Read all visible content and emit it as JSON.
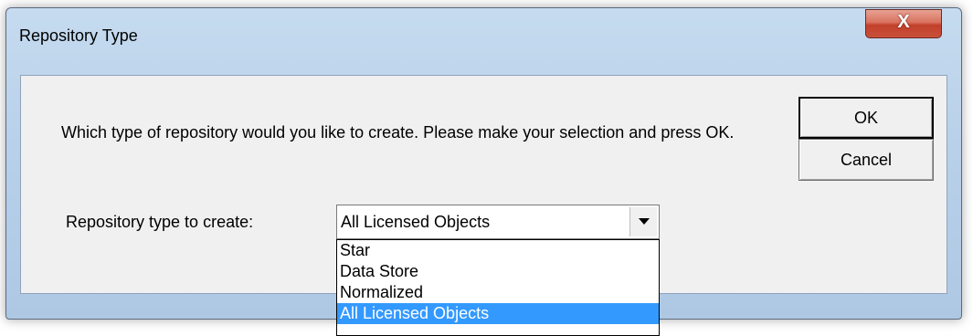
{
  "window": {
    "title": "Repository Type",
    "close_label": "X"
  },
  "dialog": {
    "prompt": "Which type of repository would you like to create. Please make your selection and press OK.",
    "ok_label": "OK",
    "cancel_label": "Cancel",
    "field_label": "Repository type to create:",
    "selected_value": "All Licensed Objects",
    "options": [
      "Star",
      "Data Store",
      "Normalized",
      "All Licensed Objects"
    ],
    "highlighted_option": "All Licensed Objects"
  },
  "colors": {
    "selection_highlight": "#3399ff",
    "close_button": "#c9503a",
    "frame": "#b9d1ea"
  }
}
